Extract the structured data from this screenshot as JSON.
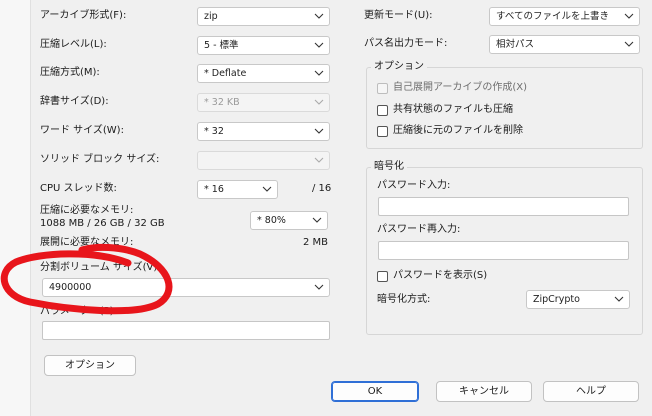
{
  "left": {
    "archive_format": {
      "label": "アーカイブ形式(F):",
      "value": "zip"
    },
    "compression_level": {
      "label": "圧縮レベル(L):",
      "value": "5 - 標準"
    },
    "compression_method": {
      "label": "圧縮方式(M):",
      "value": "* Deflate"
    },
    "dictionary_size": {
      "label": "辞書サイズ(D):",
      "value": "* 32 KB"
    },
    "word_size": {
      "label": "ワード サイズ(W):",
      "value": "* 32"
    },
    "solid_block_size": {
      "label": "ソリッド ブロック サイズ:",
      "value": ""
    },
    "cpu_threads": {
      "label": "CPU スレッド数:",
      "value": "* 16",
      "max": "/ 16"
    },
    "memory_usage": {
      "label": "圧縮に必要なメモリ:",
      "detail": "1088 MB / 26 GB / 32 GB",
      "value": "* 80%"
    },
    "decompress_memory": {
      "label": "展開に必要なメモリ:",
      "value": "2 MB"
    },
    "split_volume": {
      "label": "分割ボリューム サイズ(V):",
      "value": "4900000"
    },
    "parameters": {
      "label": "パラメーター(P):",
      "value": ""
    },
    "options_button": "オプション"
  },
  "right": {
    "update_mode": {
      "label": "更新モード(U):",
      "value": "すべてのファイルを上書き"
    },
    "path_mode": {
      "label": "パス名出力モード:",
      "value": "相対パス"
    },
    "options_group": {
      "title": "オプション",
      "sfx": "自己展開アーカイブの作成(X)",
      "shared": "共有状態のファイルも圧縮",
      "delete_after": "圧縮後に元のファイルを削除"
    },
    "encryption_group": {
      "title": "暗号化",
      "password_label": "パスワード入力:",
      "password_value": "",
      "reenter_label": "パスワード再入力:",
      "reenter_value": "",
      "show_password": "パスワードを表示(S)",
      "method_label": "暗号化方式:",
      "method_value": "ZipCrypto"
    }
  },
  "buttons": {
    "ok": "OK",
    "cancel": "キャンセル",
    "help": "ヘルプ"
  },
  "annotation": {
    "color": "#e8151b"
  }
}
